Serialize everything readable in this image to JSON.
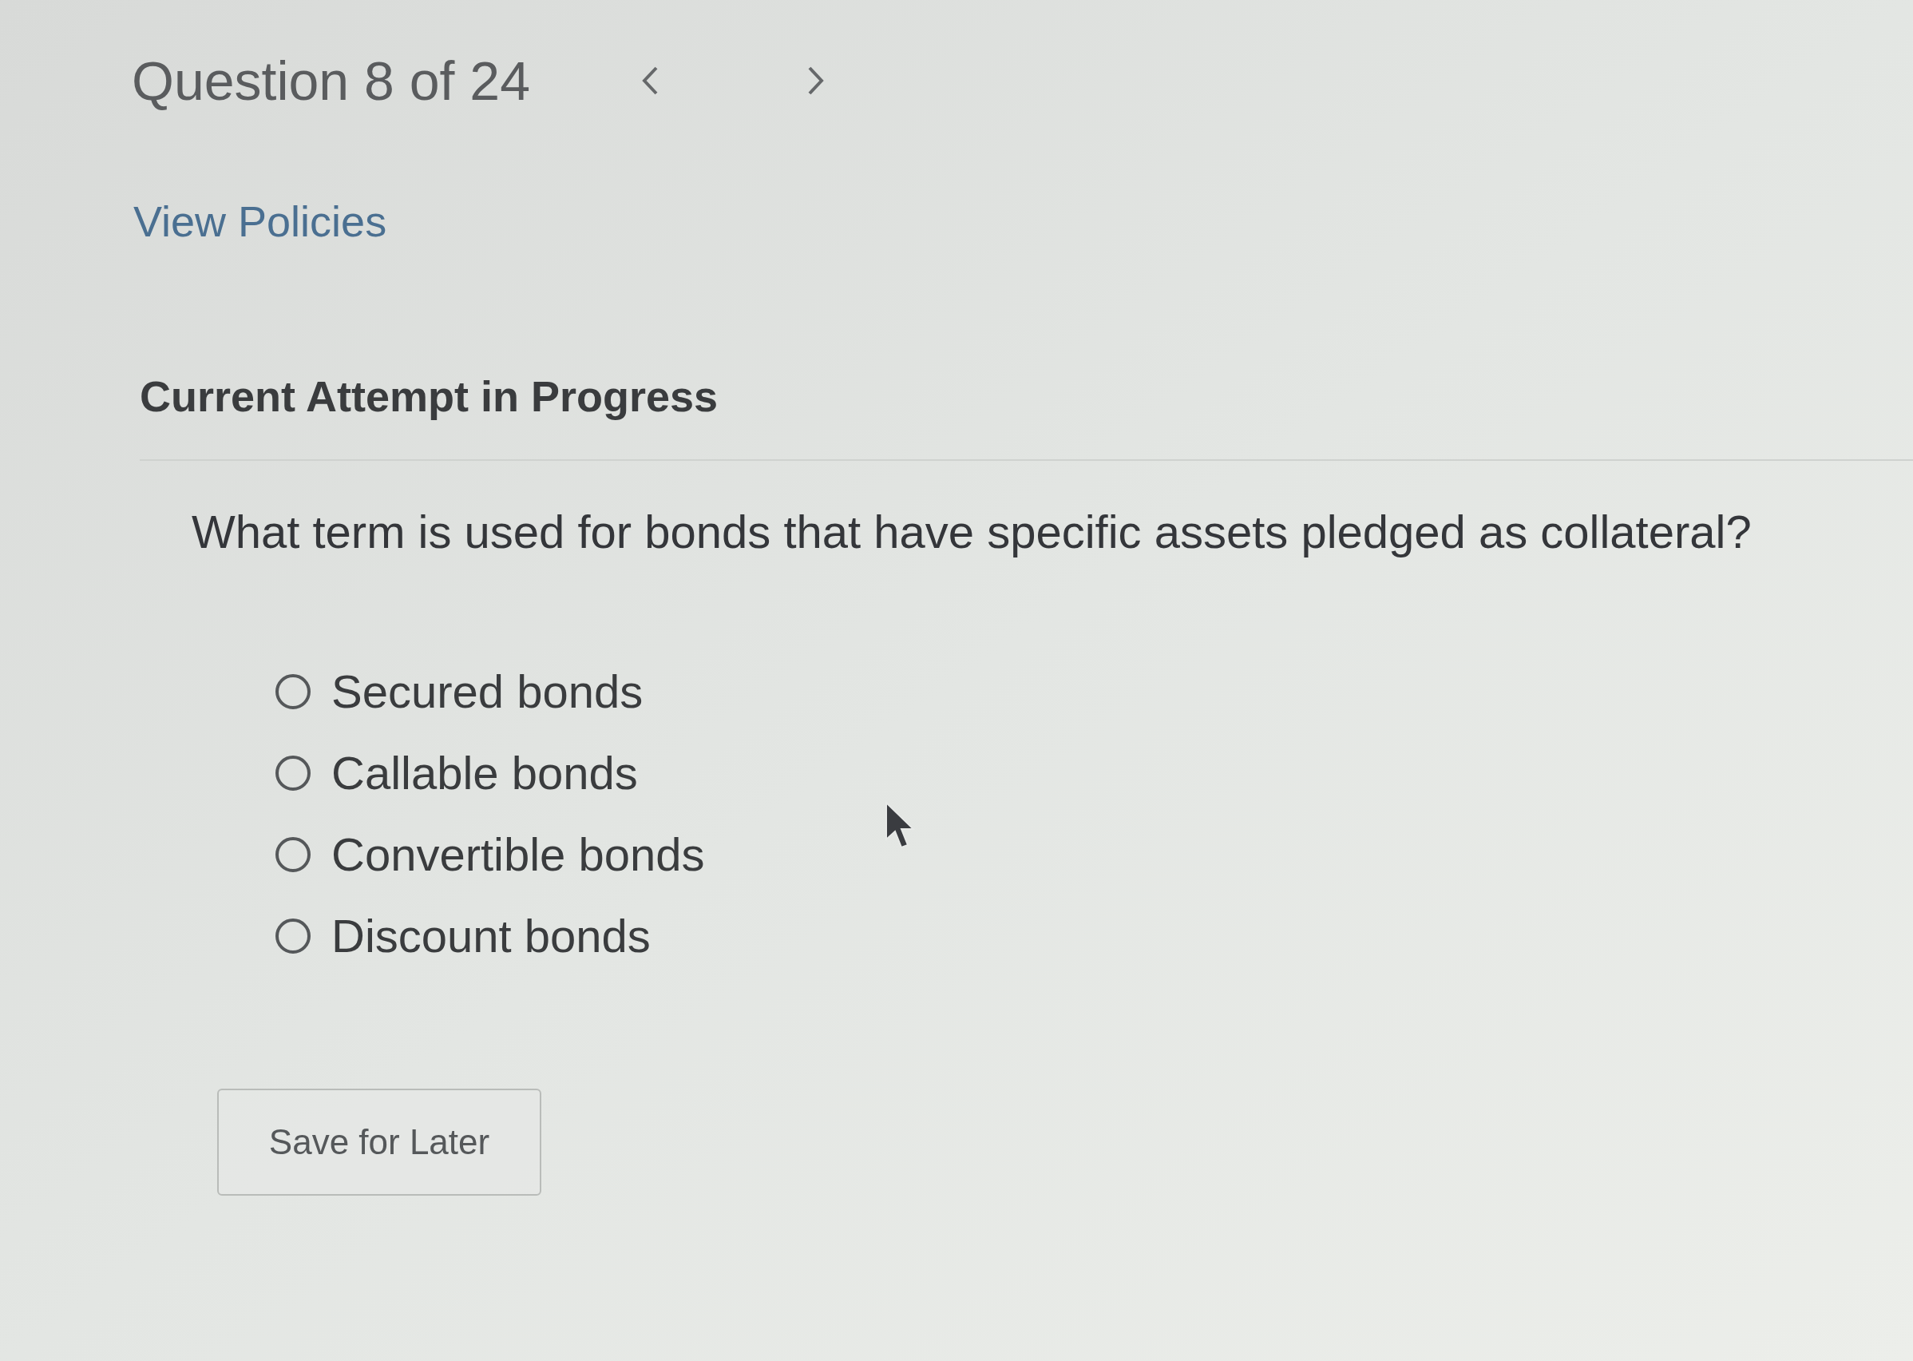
{
  "header": {
    "title": "Question 8 of 24"
  },
  "links": {
    "view_policies": "View Policies"
  },
  "section": {
    "title": "Current Attempt in Progress"
  },
  "question": {
    "text": "What term is used for bonds that have specific assets pledged as collateral?",
    "options": [
      {
        "label": "Secured bonds",
        "selected": false
      },
      {
        "label": "Callable bonds",
        "selected": false
      },
      {
        "label": "Convertible bonds",
        "selected": false
      },
      {
        "label": "Discount bonds",
        "selected": false
      }
    ]
  },
  "buttons": [
    {
      "label": "Save for Later"
    }
  ]
}
